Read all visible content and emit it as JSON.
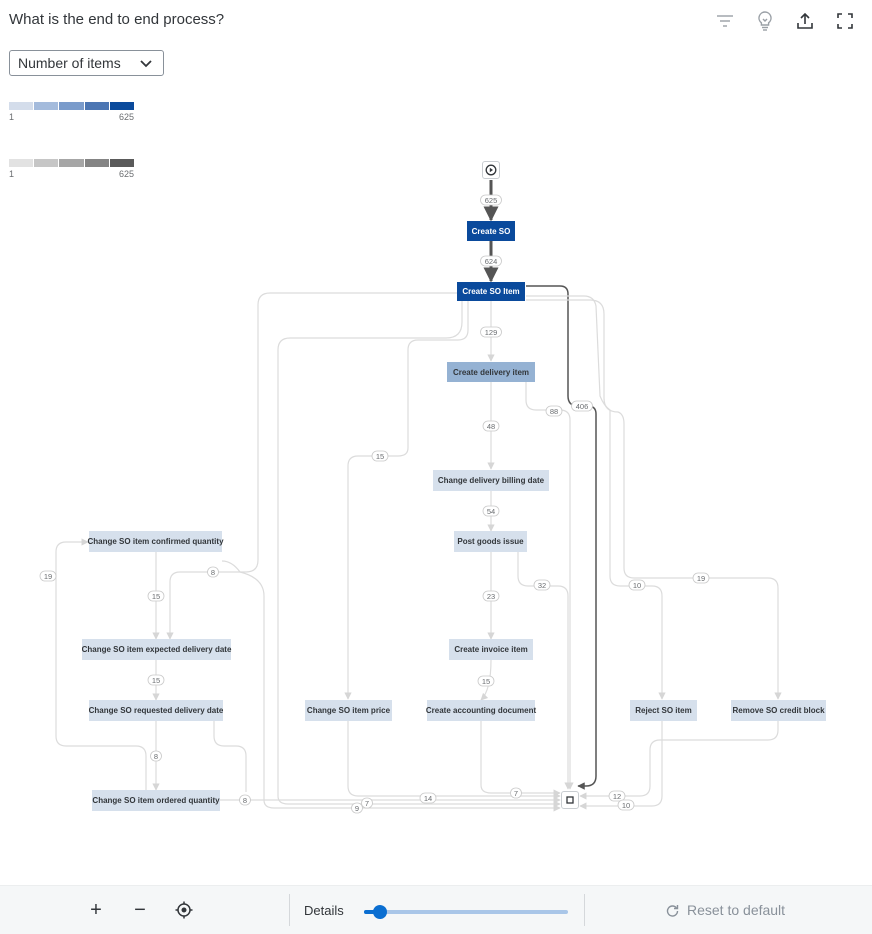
{
  "header": {
    "title": "What is the end to end process?",
    "icons": [
      "filter-icon",
      "lightbulb-icon",
      "export-icon",
      "fullscreen-icon"
    ]
  },
  "measure_select": {
    "value": "Number of items"
  },
  "legends": [
    {
      "min": "1",
      "max": "625",
      "colors": [
        "#d4ddeb",
        "#a4bbdc",
        "#7a9bcb",
        "#4c76b3",
        "#0a4a9c"
      ]
    },
    {
      "min": "1",
      "max": "625",
      "colors": [
        "#e2e2e2",
        "#c6c6c6",
        "#a6a6a6",
        "#848484",
        "#5a5a5a"
      ]
    }
  ],
  "graph": {
    "nodes": {
      "start": "",
      "end": "",
      "create_so": "Create SO",
      "create_so_item": "Create SO Item",
      "create_delivery_item": "Create delivery item",
      "change_delivery_billing_date": "Change delivery billing date",
      "post_goods_issue": "Post goods issue",
      "create_invoice_item": "Create invoice item",
      "create_accounting_document": "Create accounting document",
      "change_so_item_confirmed_quantity": "Change SO item confirmed quantity",
      "change_so_item_expected_delivery_date": "Change SO item expected delivery date",
      "change_so_requested_delivery_date": "Change SO requested delivery date",
      "change_so_item_ordered_quantity": "Change SO item ordered quantity",
      "change_so_item_price": "Change SO item price",
      "reject_so_item": "Reject SO item",
      "remove_so_credit_block": "Remove SO credit block"
    },
    "edge_labels": {
      "start_to_create_so": "625",
      "create_so_to_create_so_item": "624",
      "so_item_to_delivery_item": "129",
      "so_item_to_end": "406",
      "delivery_item_to_end": "88",
      "delivery_item_to_billing_date": "48",
      "billing_date_to_goods_issue": "54",
      "so_item_to_item_price": "15",
      "goods_issue_to_invoice_item": "23",
      "goods_issue_to_end": "32",
      "invoice_item_to_accounting_doc": "15",
      "accounting_doc_to_end": "7",
      "confirmed_qty_to_expected_date": "15",
      "loop_to_confirmed_qty": "19",
      "so_item_to_expected_date": "8",
      "expected_date_to_requested_date": "15",
      "requested_date_to_ordered_qty": "8",
      "ordered_qty_to_end": "8",
      "item_price_to_end": "7",
      "bottom_lane_9": "9",
      "bottom_lane_14": "14",
      "so_item_to_reject": "10",
      "so_item_to_credit_block": "19",
      "credit_block_to_end": "12",
      "reject_to_end": "10"
    }
  },
  "toolbar": {
    "zoom_in": "+",
    "zoom_out": "−",
    "details_label": "Details",
    "details_level": 0.08,
    "reset_label": "Reset to default"
  }
}
